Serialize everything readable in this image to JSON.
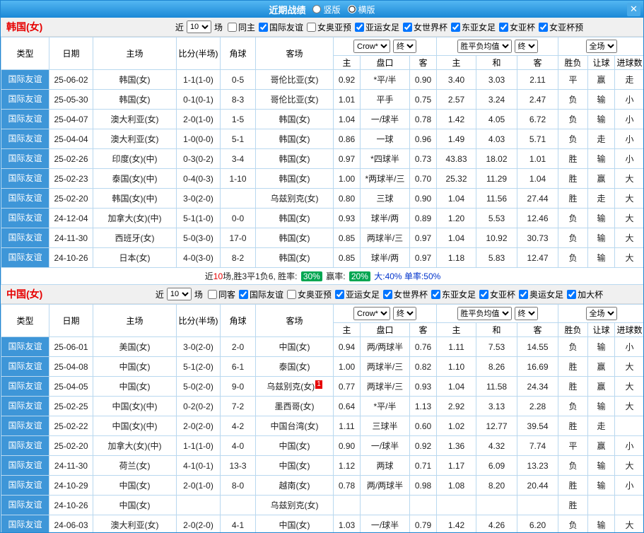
{
  "colors": {
    "accent_blue": "#3e96d8",
    "red": "#e60000",
    "green": "#009000",
    "blue": "#0033cc",
    "badge_green": "#00a651"
  },
  "titlebar": {
    "title": "近期战绩",
    "close_icon": "✕",
    "layout_options": [
      {
        "label": "竖版",
        "selected": false
      },
      {
        "label": "横版",
        "selected": true
      }
    ]
  },
  "table_header": {
    "type": "类型",
    "date": "日期",
    "home": "主场",
    "score": "比分(半场)",
    "corner": "角球",
    "away": "客场",
    "sub": [
      "主",
      "盘口",
      "客",
      "主",
      "和",
      "客",
      "胜负",
      "让球",
      "进球数"
    ]
  },
  "sections": [
    {
      "team": "韩国(女)",
      "filter": {
        "prefix": "近",
        "count": "10",
        "suffix": "场",
        "checkboxes": [
          {
            "label": "同主",
            "checked": false
          },
          {
            "label": "国际友谊",
            "checked": true
          },
          {
            "label": "女奥亚预",
            "checked": false
          },
          {
            "label": "亚运女足",
            "checked": true
          },
          {
            "label": "女世界杯",
            "checked": true
          },
          {
            "label": "东亚女足",
            "checked": true
          },
          {
            "label": "女亚杯",
            "checked": true
          },
          {
            "label": "女亚杯预",
            "checked": true
          }
        ]
      },
      "selects": {
        "company": "Crow*",
        "company_final": "终",
        "europe": "胜平负均值",
        "europe_final": "终",
        "scope": "全场"
      },
      "rows": [
        {
          "type": "国际友谊",
          "date": "25-06-02",
          "home": "韩国(女)",
          "home_red": true,
          "score": "1-1(1-0)",
          "corner": "0-5",
          "away": "哥伦比亚(女)",
          "away_red": false,
          "away_badge": "",
          "o_home": "0.92",
          "handicap": "*平/半",
          "handicap_red": true,
          "o_away": "0.90",
          "e_win": "3.40",
          "e_draw": "3.03",
          "e_lose": "2.11",
          "result": "平",
          "result_c": "blue",
          "let": "赢",
          "let_c": "red",
          "goal": "走",
          "goal_c": "blue"
        },
        {
          "type": "国际友谊",
          "date": "25-05-30",
          "home": "韩国(女)",
          "home_red": true,
          "score": "0-1(0-1)",
          "corner": "8-3",
          "away": "哥伦比亚(女)",
          "away_red": false,
          "away_badge": "",
          "o_home": "1.01",
          "handicap": "平手",
          "handicap_red": false,
          "o_away": "0.75",
          "e_win": "2.57",
          "e_draw": "3.24",
          "e_lose": "2.47",
          "result": "负",
          "result_c": "green",
          "let": "输",
          "let_c": "green",
          "goal": "小",
          "goal_c": "green"
        },
        {
          "type": "国际友谊",
          "date": "25-04-07",
          "home": "澳大利亚(女)",
          "home_red": false,
          "score": "2-0(1-0)",
          "corner": "1-5",
          "away": "韩国(女)",
          "away_red": true,
          "away_badge": "",
          "o_home": "1.04",
          "handicap": "一/球半",
          "handicap_red": false,
          "o_away": "0.78",
          "e_win": "1.42",
          "e_draw": "4.05",
          "e_lose": "6.72",
          "result": "负",
          "result_c": "green",
          "let": "输",
          "let_c": "green",
          "goal": "小",
          "goal_c": "green"
        },
        {
          "type": "国际友谊",
          "date": "25-04-04",
          "home": "澳大利亚(女)",
          "home_red": false,
          "score": "1-0(0-0)",
          "corner": "5-1",
          "away": "韩国(女)",
          "away_red": true,
          "away_badge": "",
          "o_home": "0.86",
          "handicap": "一球",
          "handicap_red": false,
          "o_away": "0.96",
          "e_win": "1.49",
          "e_draw": "4.03",
          "e_lose": "5.71",
          "result": "负",
          "result_c": "green",
          "let": "走",
          "let_c": "blue",
          "goal": "小",
          "goal_c": "green"
        },
        {
          "type": "国际友谊",
          "date": "25-02-26",
          "home": "印度(女)(中)",
          "home_red": false,
          "score": "0-3(0-2)",
          "corner": "3-4",
          "away": "韩国(女)",
          "away_red": true,
          "away_badge": "",
          "o_home": "0.97",
          "handicap": "*四球半",
          "handicap_red": true,
          "o_away": "0.73",
          "e_win": "43.83",
          "e_draw": "18.02",
          "e_lose": "1.01",
          "result": "胜",
          "result_c": "red",
          "let": "输",
          "let_c": "green",
          "goal": "小",
          "goal_c": "green"
        },
        {
          "type": "国际友谊",
          "date": "25-02-23",
          "home": "泰国(女)(中)",
          "home_red": false,
          "score": "0-4(0-3)",
          "corner": "1-10",
          "away": "韩国(女)",
          "away_red": true,
          "away_badge": "",
          "o_home": "1.00",
          "handicap": "*两球半/三",
          "handicap_red": true,
          "o_away": "0.70",
          "e_win": "25.32",
          "e_draw": "11.29",
          "e_lose": "1.04",
          "result": "胜",
          "result_c": "red",
          "let": "赢",
          "let_c": "red",
          "goal": "大",
          "goal_c": "red"
        },
        {
          "type": "国际友谊",
          "date": "25-02-20",
          "home": "韩国(女)(中)",
          "home_red": true,
          "score": "3-0(2-0)",
          "corner": "",
          "away": "乌兹别克(女)",
          "away_red": false,
          "away_badge": "",
          "o_home": "0.80",
          "handicap": "三球",
          "handicap_red": false,
          "o_away": "0.90",
          "e_win": "1.04",
          "e_draw": "11.56",
          "e_lose": "27.44",
          "result": "胜",
          "result_c": "red",
          "let": "走",
          "let_c": "blue",
          "goal": "大",
          "goal_c": "red"
        },
        {
          "type": "国际友谊",
          "date": "24-12-04",
          "home": "加拿大(女)(中)",
          "home_red": false,
          "score": "5-1(1-0)",
          "corner": "0-0",
          "away": "韩国(女)",
          "away_red": true,
          "away_badge": "",
          "o_home": "0.93",
          "handicap": "球半/两",
          "handicap_red": false,
          "o_away": "0.89",
          "e_win": "1.20",
          "e_draw": "5.53",
          "e_lose": "12.46",
          "result": "负",
          "result_c": "green",
          "let": "输",
          "let_c": "green",
          "goal": "大",
          "goal_c": "red"
        },
        {
          "type": "国际友谊",
          "date": "24-11-30",
          "home": "西班牙(女)",
          "home_red": false,
          "score": "5-0(3-0)",
          "corner": "17-0",
          "away": "韩国(女)",
          "away_red": true,
          "away_badge": "",
          "o_home": "0.85",
          "handicap": "两球半/三",
          "handicap_red": false,
          "o_away": "0.97",
          "e_win": "1.04",
          "e_draw": "10.92",
          "e_lose": "30.73",
          "result": "负",
          "result_c": "green",
          "let": "输",
          "let_c": "green",
          "goal": "大",
          "goal_c": "red"
        },
        {
          "type": "国际友谊",
          "date": "24-10-26",
          "home": "日本(女)",
          "home_red": false,
          "score": "4-0(3-0)",
          "corner": "8-2",
          "away": "韩国(女)",
          "away_red": true,
          "away_badge": "",
          "o_home": "0.85",
          "handicap": "球半/两",
          "handicap_red": false,
          "o_away": "0.97",
          "e_win": "1.18",
          "e_draw": "5.83",
          "e_lose": "12.47",
          "result": "负",
          "result_c": "green",
          "let": "输",
          "let_c": "green",
          "goal": "大",
          "goal_c": "red"
        }
      ],
      "summary": [
        {
          "text": "近",
          "style": "plain"
        },
        {
          "text": "10",
          "style": "red"
        },
        {
          "text": "场,胜3平1负6, 胜率: ",
          "style": "plain"
        },
        {
          "text": "30%",
          "style": "badge"
        },
        {
          "text": " 赢率: ",
          "style": "plain"
        },
        {
          "text": "20%",
          "style": "badge"
        },
        {
          "text": " 大:40% ",
          "style": "blue"
        },
        {
          "text": "单率:50%",
          "style": "blue"
        }
      ]
    },
    {
      "team": "中国(女)",
      "filter": {
        "prefix": "近",
        "count": "10",
        "suffix": "场",
        "checkboxes": [
          {
            "label": "同客",
            "checked": false
          },
          {
            "label": "国际友谊",
            "checked": true
          },
          {
            "label": "女奥亚预",
            "checked": false
          },
          {
            "label": "亚运女足",
            "checked": true
          },
          {
            "label": "女世界杯",
            "checked": true
          },
          {
            "label": "东亚女足",
            "checked": true
          },
          {
            "label": "女亚杯",
            "checked": true
          },
          {
            "label": "奥运女足",
            "checked": true
          },
          {
            "label": "加大杯",
            "checked": true
          }
        ]
      },
      "selects": {
        "company": "Crow*",
        "company_final": "终",
        "europe": "胜平负均值",
        "europe_final": "终",
        "scope": "全场"
      },
      "rows": [
        {
          "type": "国际友谊",
          "date": "25-06-01",
          "home": "美国(女)",
          "home_red": false,
          "score": "3-0(2-0)",
          "corner": "2-0",
          "away": "中国(女)",
          "away_red": true,
          "away_badge": "",
          "o_home": "0.94",
          "handicap": "两/两球半",
          "handicap_red": false,
          "o_away": "0.76",
          "e_win": "1.11",
          "e_draw": "7.53",
          "e_lose": "14.55",
          "result": "负",
          "result_c": "green",
          "let": "输",
          "let_c": "green",
          "goal": "小",
          "goal_c": "green"
        },
        {
          "type": "国际友谊",
          "date": "25-04-08",
          "home": "中国(女)",
          "home_red": true,
          "score": "5-1(2-0)",
          "corner": "6-1",
          "away": "泰国(女)",
          "away_red": false,
          "away_badge": "",
          "o_home": "1.00",
          "handicap": "两球半/三",
          "handicap_red": false,
          "o_away": "0.82",
          "e_win": "1.10",
          "e_draw": "8.26",
          "e_lose": "16.69",
          "result": "胜",
          "result_c": "red",
          "let": "赢",
          "let_c": "red",
          "goal": "大",
          "goal_c": "red"
        },
        {
          "type": "国际友谊",
          "date": "25-04-05",
          "home": "中国(女)",
          "home_red": true,
          "score": "5-0(2-0)",
          "corner": "9-0",
          "away": "乌兹别克(女)",
          "away_red": false,
          "away_badge": "1",
          "o_home": "0.77",
          "handicap": "两球半/三",
          "handicap_red": false,
          "o_away": "0.93",
          "e_win": "1.04",
          "e_draw": "11.58",
          "e_lose": "24.34",
          "result": "胜",
          "result_c": "red",
          "let": "赢",
          "let_c": "red",
          "goal": "大",
          "goal_c": "red"
        },
        {
          "type": "国际友谊",
          "date": "25-02-25",
          "home": "中国(女)(中)",
          "home_red": true,
          "score": "0-2(0-2)",
          "corner": "7-2",
          "away": "墨西哥(女)",
          "away_red": false,
          "away_badge": "",
          "o_home": "0.64",
          "handicap": "*平/半",
          "handicap_red": true,
          "o_away": "1.13",
          "e_win": "2.92",
          "e_draw": "3.13",
          "e_lose": "2.28",
          "result": "负",
          "result_c": "green",
          "let": "输",
          "let_c": "green",
          "goal": "大",
          "goal_c": "red"
        },
        {
          "type": "国际友谊",
          "date": "25-02-22",
          "home": "中国(女)(中)",
          "home_red": true,
          "score": "2-0(2-0)",
          "corner": "4-2",
          "away": "中国台湾(女)",
          "away_red": false,
          "away_badge": "",
          "o_home": "1.11",
          "handicap": "三球半",
          "handicap_red": false,
          "o_away": "0.60",
          "e_win": "1.02",
          "e_draw": "12.77",
          "e_lose": "39.54",
          "result": "胜",
          "result_c": "red",
          "let": "走",
          "let_c": "blue",
          "goal": "",
          "goal_c": "blue"
        },
        {
          "type": "国际友谊",
          "date": "25-02-20",
          "home": "加拿大(女)(中)",
          "home_red": false,
          "score": "1-1(1-0)",
          "corner": "4-0",
          "away": "中国(女)",
          "away_red": true,
          "away_badge": "",
          "o_home": "0.90",
          "handicap": "一/球半",
          "handicap_red": false,
          "o_away": "0.92",
          "e_win": "1.36",
          "e_draw": "4.32",
          "e_lose": "7.74",
          "result": "平",
          "result_c": "blue",
          "let": "赢",
          "let_c": "red",
          "goal": "小",
          "goal_c": "green"
        },
        {
          "type": "国际友谊",
          "date": "24-11-30",
          "home": "荷兰(女)",
          "home_red": false,
          "score": "4-1(0-1)",
          "corner": "13-3",
          "away": "中国(女)",
          "away_red": true,
          "away_badge": "",
          "o_home": "1.12",
          "handicap": "两球",
          "handicap_red": false,
          "o_away": "0.71",
          "e_win": "1.17",
          "e_draw": "6.09",
          "e_lose": "13.23",
          "result": "负",
          "result_c": "green",
          "let": "输",
          "let_c": "green",
          "goal": "大",
          "goal_c": "red"
        },
        {
          "type": "国际友谊",
          "date": "24-10-29",
          "home": "中国(女)",
          "home_red": true,
          "score": "2-0(1-0)",
          "corner": "8-0",
          "away": "越南(女)",
          "away_red": false,
          "away_badge": "",
          "o_home": "0.78",
          "handicap": "两/两球半",
          "handicap_red": false,
          "o_away": "0.98",
          "e_win": "1.08",
          "e_draw": "8.20",
          "e_lose": "20.44",
          "result": "胜",
          "result_c": "red",
          "let": "输",
          "let_c": "green",
          "goal": "小",
          "goal_c": "green"
        },
        {
          "type": "国际友谊",
          "date": "24-10-26",
          "home": "中国(女)",
          "home_red": true,
          "score": "",
          "corner": "",
          "away": "乌兹别克(女)",
          "away_red": false,
          "away_badge": "",
          "o_home": "",
          "handicap": "",
          "handicap_red": false,
          "o_away": "",
          "e_win": "",
          "e_draw": "",
          "e_lose": "",
          "result": "胜",
          "result_c": "red",
          "let": "",
          "let_c": "blue",
          "goal": "",
          "goal_c": "blue"
        },
        {
          "type": "国际友谊",
          "date": "24-06-03",
          "home": "澳大利亚(女)",
          "home_red": false,
          "score": "2-0(2-0)",
          "corner": "4-1",
          "away": "中国(女)",
          "away_red": true,
          "away_badge": "",
          "o_home": "1.03",
          "handicap": "一/球半",
          "handicap_red": false,
          "o_away": "0.79",
          "e_win": "1.42",
          "e_draw": "4.26",
          "e_lose": "6.20",
          "result": "负",
          "result_c": "green",
          "let": "输",
          "let_c": "green",
          "goal": "大",
          "goal_c": "red"
        }
      ],
      "summary": null
    }
  ]
}
